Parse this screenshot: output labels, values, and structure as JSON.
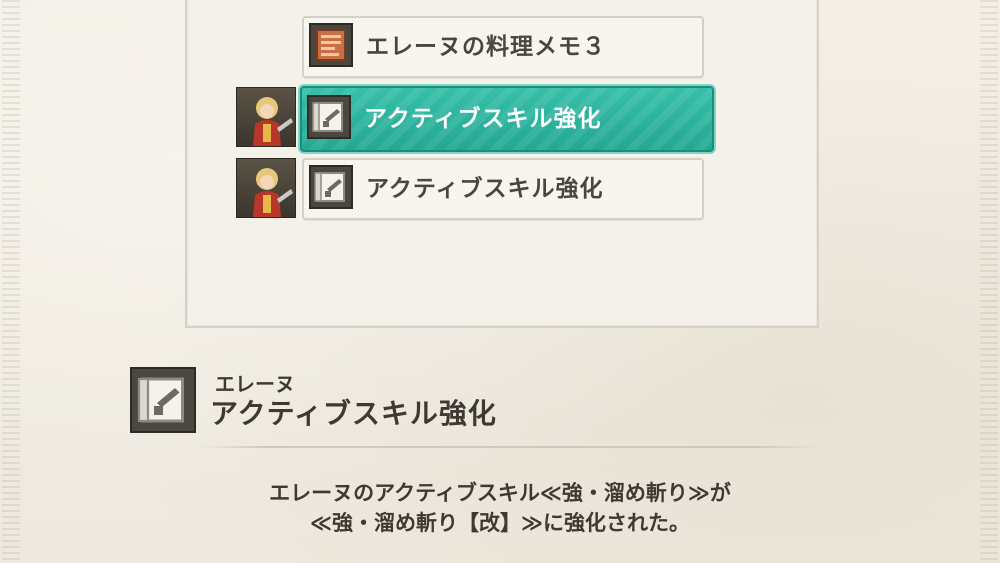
{
  "items": [
    {
      "label": "エレーヌの料理メモ３",
      "icon": "recipe-scroll-icon",
      "has_portrait": false
    },
    {
      "label": "アクティブスキル強化",
      "icon": "skill-scroll-icon",
      "has_portrait": true,
      "selected": true
    },
    {
      "label": "アクティブスキル強化",
      "icon": "skill-scroll-icon",
      "has_portrait": true
    }
  ],
  "detail": {
    "owner": "エレーヌ",
    "title": "アクティブスキル強化",
    "description_line1": "エレーヌのアクティブスキル≪強・溜め斬り≫が",
    "description_line2": "≪強・溜め斬り【改】≫に強化された。"
  },
  "colors": {
    "selected_bg": "#2bb39d",
    "background": "#f1ede3",
    "text": "#3e3a33"
  }
}
